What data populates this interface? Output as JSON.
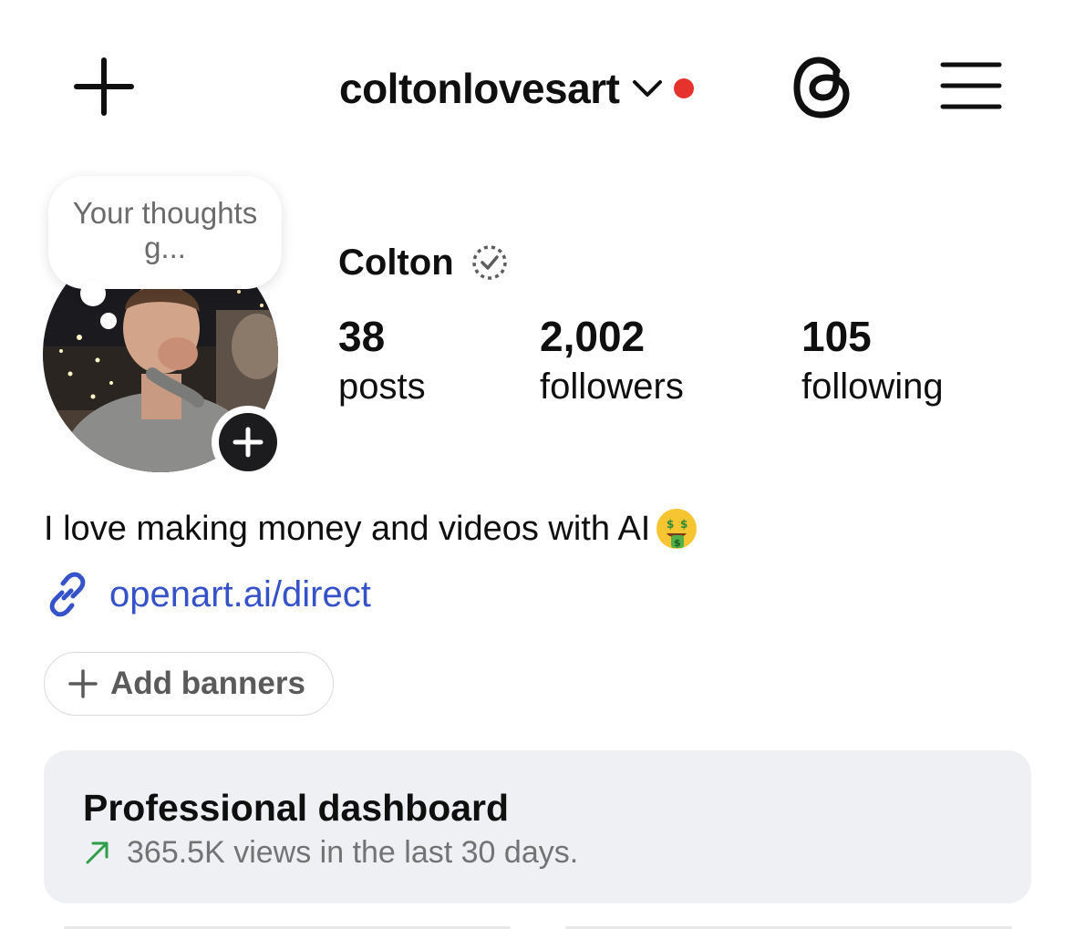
{
  "header": {
    "username": "coltonlovesart",
    "notification_dot_color": "#e5322d",
    "create_icon": "plus-icon",
    "threads_icon": "threads-icon",
    "menu_icon": "hamburger-menu-icon"
  },
  "note": {
    "text": "Your thoughts g..."
  },
  "profile": {
    "display_name": "Colton",
    "verified_icon": "meta-verified-pending-icon",
    "stats": {
      "posts": {
        "value": "38",
        "label": "posts"
      },
      "followers": {
        "value": "2,002",
        "label": "followers"
      },
      "following": {
        "value": "105",
        "label": "following"
      }
    },
    "bio": "I love making money and videos with AI",
    "bio_emoji": "money-mouth-face",
    "link": "openart.ai/direct",
    "link_color": "#3552c9"
  },
  "actions": {
    "add_banners_label": "Add banners"
  },
  "dashboard": {
    "title": "Professional dashboard",
    "subtitle": "365.5K views in the last 30 days.",
    "trend_color": "#2e9e4a"
  }
}
